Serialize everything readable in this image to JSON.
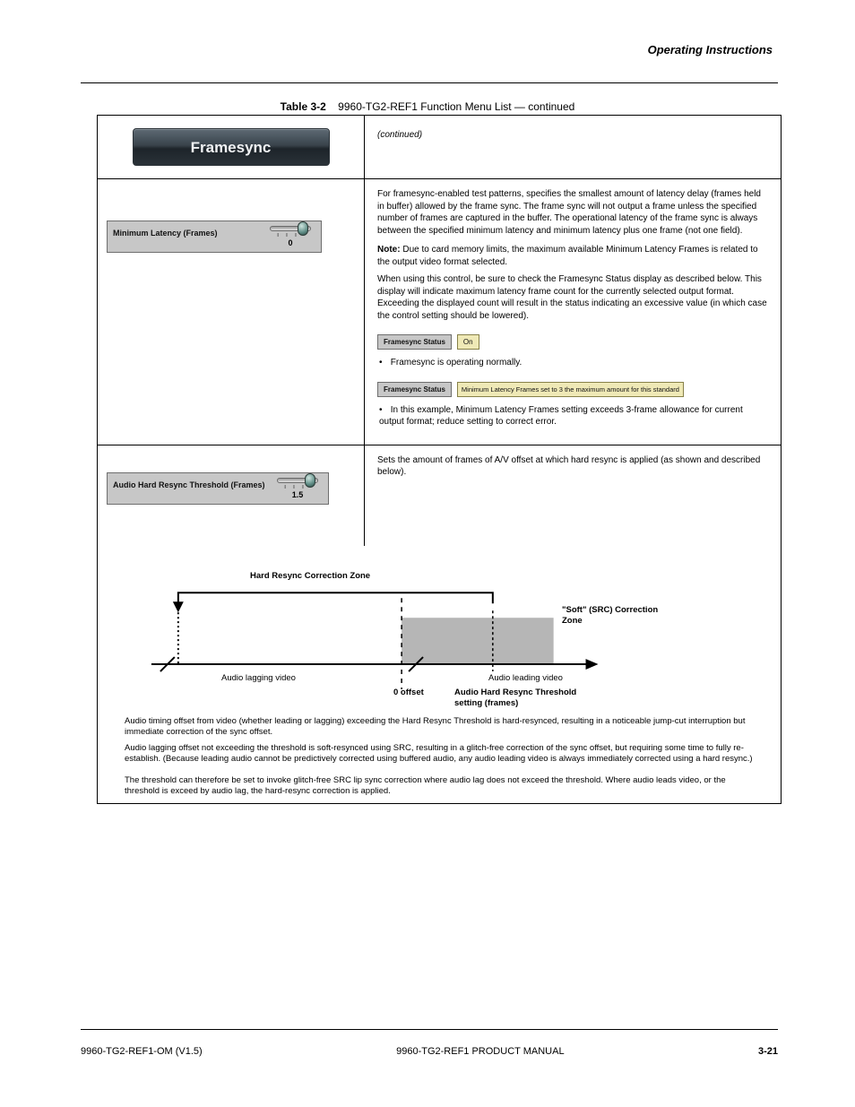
{
  "header": {
    "title": "Operating Instructions"
  },
  "table_caption": {
    "label": "Table 3-2",
    "text": "9960-TG2-REF1 Function Menu List — continued"
  },
  "row_header": {
    "badge": "Framesync",
    "continued": "(continued)"
  },
  "row_min_latency": {
    "control_label": "Minimum Latency (Frames)",
    "slider_value": "0",
    "desc": "For framesync-enabled test patterns, specifies the smallest amount of latency delay (frames held in buffer) allowed by the frame sync. The frame sync will not output a frame unless the specified number of frames are captured in the buffer. The operational latency of the frame sync is always between the specified minimum latency and minimum latency plus one frame (not one field).",
    "note_label": "Note:",
    "note": "Due to card memory limits, the maximum available Minimum Latency Frames is related to the output video format selected.",
    "note_ex": "When using this control, be sure to check the Framesync Status display as described below. This display will indicate maximum latency frame count for the currently selected output format. Exceeding the displayed count will result in the status indicating an excessive value (in which case the control setting should be lowered).",
    "status1_label": "Framesync Status",
    "status1_value": "On",
    "status1_bullet": "Framesync is operating normally.",
    "status2_label": "Framesync Status",
    "status2_value": "Minimum Latency Frames set to 3 the maximum amount for this standard",
    "status2_bullet": "In this example, Minimum Latency Frames setting exceeds 3-frame allowance for current output format; reduce setting to correct error."
  },
  "row_resync": {
    "control_label": "Audio Hard Resync Threshold (Frames)",
    "slider_value": "1.5",
    "desc": "Sets the amount of frames of A/V offset at which hard resync is applied (as shown and described below)."
  },
  "diagram": {
    "hard_zone": "Hard Resync Correction Zone",
    "soft_zone": "\"Soft\" (SRC) Correction Zone",
    "axis_label_left": "Audio lagging video",
    "axis_label_right": "Audio leading video",
    "marker_zero": "0 offset",
    "marker_thr": "Audio Hard Resync Threshold setting (frames)",
    "para1": "Audio timing offset from video (whether leading or lagging) exceeding the Hard Resync Threshold is hard-resynced, resulting in a noticeable jump-cut interruption but immediate correction of the sync offset.",
    "para2": "Audio lagging offset not exceeding the threshold is soft-resynced using SRC, resulting in a glitch-free correction of the sync offset, but requiring some time to fully re-establish. (Because leading audio cannot be predictively corrected using buffered audio, any audio leading video is always immediately corrected using a hard resync.)",
    "para3": "The threshold can therefore be set to invoke glitch-free SRC lip sync correction where audio lag does not exceed the threshold. Where audio leads video, or the threshold is exceed by audio lag, the hard-resync correction is applied."
  },
  "footer": {
    "rev": "9960-TG2-REF1 PRODUCT MANUAL",
    "doc": "9960-TG2-REF1-OM (V1.5)",
    "page": "3-21"
  }
}
